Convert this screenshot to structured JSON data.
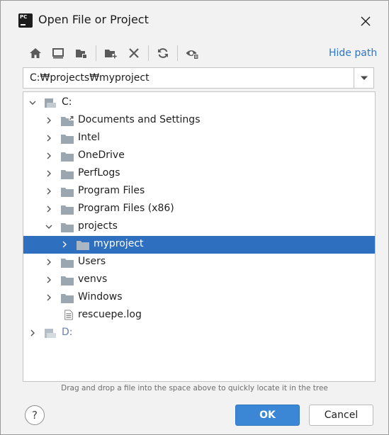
{
  "window": {
    "title": "Open File or Project",
    "app_icon_text": "PC"
  },
  "toolbar": {
    "icons": [
      "home-icon",
      "desktop-icon",
      "project-folder-icon",
      "new-folder-icon",
      "delete-icon",
      "refresh-icon",
      "show-hidden-icon"
    ],
    "hide_path_label": "Hide path"
  },
  "path": {
    "value": "C:₩projects₩myproject"
  },
  "tree": {
    "drive_c": "C:",
    "items": [
      {
        "label": "Documents and Settings",
        "type": "folder-link"
      },
      {
        "label": "Intel",
        "type": "folder"
      },
      {
        "label": "OneDrive",
        "type": "folder"
      },
      {
        "label": "PerfLogs",
        "type": "folder"
      },
      {
        "label": "Program Files",
        "type": "folder"
      },
      {
        "label": "Program Files (x86)",
        "type": "folder"
      },
      {
        "label": "projects",
        "type": "folder",
        "expanded": true
      },
      {
        "label": "myproject",
        "type": "folder",
        "selected": true
      },
      {
        "label": "Users",
        "type": "folder"
      },
      {
        "label": "venvs",
        "type": "folder"
      },
      {
        "label": "Windows",
        "type": "folder"
      },
      {
        "label": "rescuepe.log",
        "type": "file"
      }
    ],
    "drive_d": "D:"
  },
  "hint": "Drag and drop a file into the space above to quickly locate it in the tree",
  "buttons": {
    "help": "?",
    "ok": "OK",
    "cancel": "Cancel"
  },
  "colors": {
    "accent": "#3b87d5",
    "selection": "#2f6fc0",
    "link": "#2d77c9",
    "folder": "#9aa7b0"
  }
}
